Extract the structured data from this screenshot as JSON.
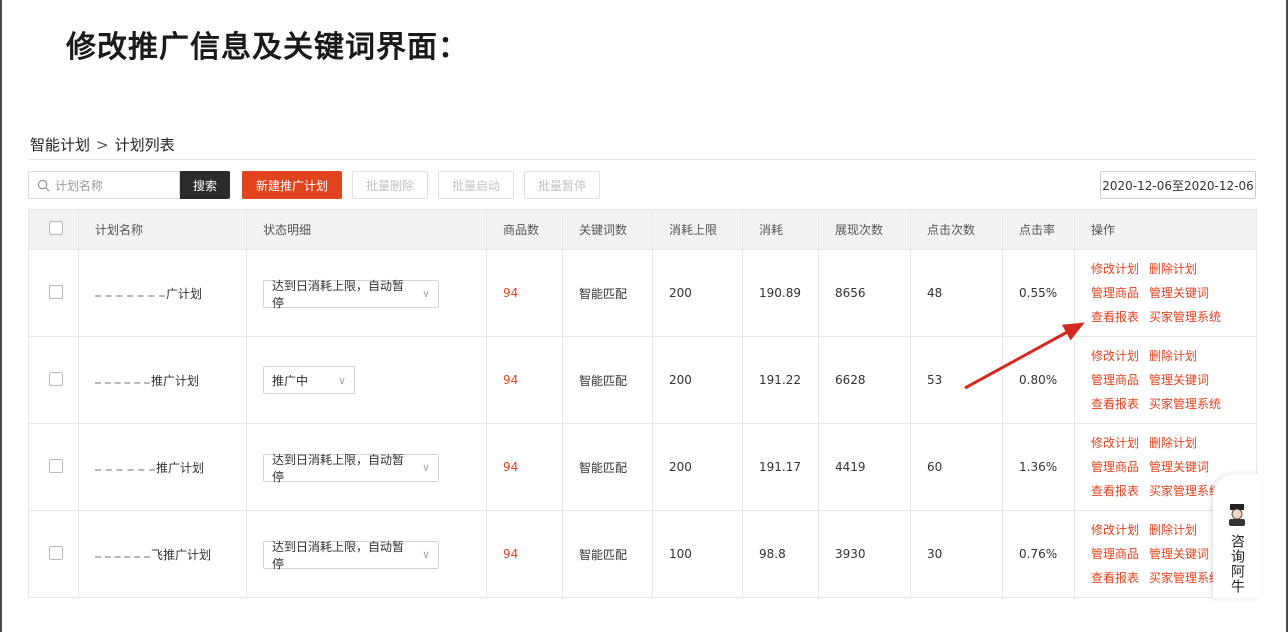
{
  "heading": "修改推广信息及关键词界面：",
  "breadcrumb": {
    "root": "智能计划",
    "separator": ">",
    "current": "计划列表"
  },
  "toolbar": {
    "search_placeholder": "计划名称",
    "search_button": "搜索",
    "new_plan": "新建推广计划",
    "batch_delete": "批量删除",
    "batch_start": "批量启动",
    "batch_pause": "批量暂停",
    "date_range": "2020-12-06至2020-12-06"
  },
  "table": {
    "headers": [
      "计划名称",
      "状态明细",
      "商品数",
      "关键词数",
      "消耗上限",
      "消耗",
      "展现次数",
      "点击次数",
      "点击率",
      "操作"
    ],
    "rows": [
      {
        "name_suffix": "广计划",
        "status": "达到日消耗上限，自动暂停",
        "products": "94",
        "keywords": "智能匹配",
        "limit": "200",
        "cost": "190.89",
        "impressions": "8656",
        "clicks": "48",
        "ctr": "0.55%"
      },
      {
        "name_suffix": "推广计划",
        "status": "推广中",
        "products": "94",
        "keywords": "智能匹配",
        "limit": "200",
        "cost": "191.22",
        "impressions": "6628",
        "clicks": "53",
        "ctr": "0.80%"
      },
      {
        "name_suffix": "推广计划",
        "status": "达到日消耗上限，自动暂停",
        "products": "94",
        "keywords": "智能匹配",
        "limit": "200",
        "cost": "191.17",
        "impressions": "4419",
        "clicks": "60",
        "ctr": "1.36%"
      },
      {
        "name_suffix": "飞推广计划",
        "status": "达到日消耗上限，自动暂停",
        "products": "94",
        "keywords": "智能匹配",
        "limit": "100",
        "cost": "98.8",
        "impressions": "3930",
        "clicks": "30",
        "ctr": "0.76%"
      }
    ],
    "ops": {
      "edit": "修改计划",
      "delete": "删除计划",
      "goods": "管理商品",
      "keywords": "管理关键词",
      "report": "查看报表",
      "buyer": "买家管理系统"
    }
  },
  "consult": {
    "label": "咨询阿牛"
  },
  "colors": {
    "accent": "#e2431f",
    "dark_button": "#2b2b2b",
    "annotation_arrow": "#d42a1e"
  },
  "icons": {
    "search": "search-icon",
    "dropdown": "chevron-down-icon",
    "assistant": "avatar-icon"
  }
}
